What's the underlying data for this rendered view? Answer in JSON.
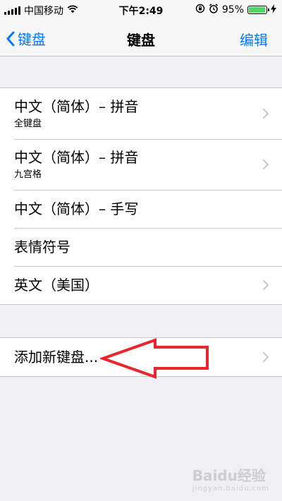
{
  "status_bar": {
    "carrier": "中国移动",
    "time": "下午2:49",
    "battery_percent": "95%",
    "battery_level": 0.95,
    "icons": [
      "signal-icon",
      "wifi-icon",
      "orientation-lock-icon",
      "alarm-icon",
      "battery-icon",
      "charging-icon"
    ]
  },
  "nav": {
    "back_label": "键盘",
    "title": "键盘",
    "edit_label": "编辑"
  },
  "keyboards": [
    {
      "title": "中文（简体）– 拼音",
      "subtitle": "全键盘",
      "chevron": true
    },
    {
      "title": "中文（简体）– 拼音",
      "subtitle": "九宫格",
      "chevron": true
    },
    {
      "title": "中文（简体）– 手写",
      "subtitle": "",
      "chevron": false
    },
    {
      "title": "表情符号",
      "subtitle": "",
      "chevron": false
    },
    {
      "title": "英文（美国）",
      "subtitle": "",
      "chevron": true
    }
  ],
  "add_keyboard": {
    "title": "添加新键盘..."
  },
  "watermark": {
    "text": "Baidu经验",
    "sub": "jingyan.baidu.com"
  },
  "colors": {
    "accent": "#007aff",
    "background": "#efeff4",
    "annotation_arrow": "#e8262d",
    "battery": "#4cd964"
  }
}
